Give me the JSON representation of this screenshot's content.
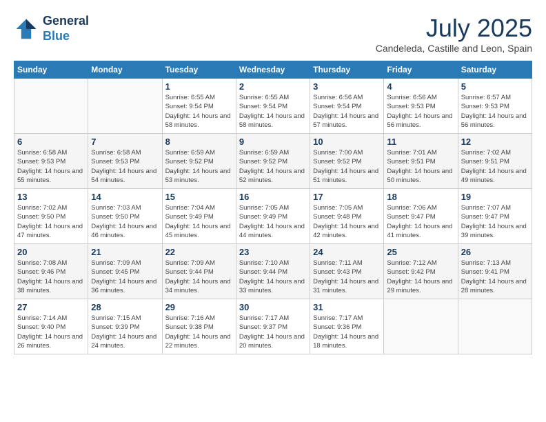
{
  "header": {
    "logo_line1": "General",
    "logo_line2": "Blue",
    "month": "July 2025",
    "location": "Candeleda, Castille and Leon, Spain"
  },
  "weekdays": [
    "Sunday",
    "Monday",
    "Tuesday",
    "Wednesday",
    "Thursday",
    "Friday",
    "Saturday"
  ],
  "weeks": [
    [
      {
        "day": "",
        "sunrise": "",
        "sunset": "",
        "daylight": ""
      },
      {
        "day": "",
        "sunrise": "",
        "sunset": "",
        "daylight": ""
      },
      {
        "day": "1",
        "sunrise": "Sunrise: 6:55 AM",
        "sunset": "Sunset: 9:54 PM",
        "daylight": "Daylight: 14 hours and 58 minutes."
      },
      {
        "day": "2",
        "sunrise": "Sunrise: 6:55 AM",
        "sunset": "Sunset: 9:54 PM",
        "daylight": "Daylight: 14 hours and 58 minutes."
      },
      {
        "day": "3",
        "sunrise": "Sunrise: 6:56 AM",
        "sunset": "Sunset: 9:54 PM",
        "daylight": "Daylight: 14 hours and 57 minutes."
      },
      {
        "day": "4",
        "sunrise": "Sunrise: 6:56 AM",
        "sunset": "Sunset: 9:53 PM",
        "daylight": "Daylight: 14 hours and 56 minutes."
      },
      {
        "day": "5",
        "sunrise": "Sunrise: 6:57 AM",
        "sunset": "Sunset: 9:53 PM",
        "daylight": "Daylight: 14 hours and 56 minutes."
      }
    ],
    [
      {
        "day": "6",
        "sunrise": "Sunrise: 6:58 AM",
        "sunset": "Sunset: 9:53 PM",
        "daylight": "Daylight: 14 hours and 55 minutes."
      },
      {
        "day": "7",
        "sunrise": "Sunrise: 6:58 AM",
        "sunset": "Sunset: 9:53 PM",
        "daylight": "Daylight: 14 hours and 54 minutes."
      },
      {
        "day": "8",
        "sunrise": "Sunrise: 6:59 AM",
        "sunset": "Sunset: 9:52 PM",
        "daylight": "Daylight: 14 hours and 53 minutes."
      },
      {
        "day": "9",
        "sunrise": "Sunrise: 6:59 AM",
        "sunset": "Sunset: 9:52 PM",
        "daylight": "Daylight: 14 hours and 52 minutes."
      },
      {
        "day": "10",
        "sunrise": "Sunrise: 7:00 AM",
        "sunset": "Sunset: 9:52 PM",
        "daylight": "Daylight: 14 hours and 51 minutes."
      },
      {
        "day": "11",
        "sunrise": "Sunrise: 7:01 AM",
        "sunset": "Sunset: 9:51 PM",
        "daylight": "Daylight: 14 hours and 50 minutes."
      },
      {
        "day": "12",
        "sunrise": "Sunrise: 7:02 AM",
        "sunset": "Sunset: 9:51 PM",
        "daylight": "Daylight: 14 hours and 49 minutes."
      }
    ],
    [
      {
        "day": "13",
        "sunrise": "Sunrise: 7:02 AM",
        "sunset": "Sunset: 9:50 PM",
        "daylight": "Daylight: 14 hours and 47 minutes."
      },
      {
        "day": "14",
        "sunrise": "Sunrise: 7:03 AM",
        "sunset": "Sunset: 9:50 PM",
        "daylight": "Daylight: 14 hours and 46 minutes."
      },
      {
        "day": "15",
        "sunrise": "Sunrise: 7:04 AM",
        "sunset": "Sunset: 9:49 PM",
        "daylight": "Daylight: 14 hours and 45 minutes."
      },
      {
        "day": "16",
        "sunrise": "Sunrise: 7:05 AM",
        "sunset": "Sunset: 9:49 PM",
        "daylight": "Daylight: 14 hours and 44 minutes."
      },
      {
        "day": "17",
        "sunrise": "Sunrise: 7:05 AM",
        "sunset": "Sunset: 9:48 PM",
        "daylight": "Daylight: 14 hours and 42 minutes."
      },
      {
        "day": "18",
        "sunrise": "Sunrise: 7:06 AM",
        "sunset": "Sunset: 9:47 PM",
        "daylight": "Daylight: 14 hours and 41 minutes."
      },
      {
        "day": "19",
        "sunrise": "Sunrise: 7:07 AM",
        "sunset": "Sunset: 9:47 PM",
        "daylight": "Daylight: 14 hours and 39 minutes."
      }
    ],
    [
      {
        "day": "20",
        "sunrise": "Sunrise: 7:08 AM",
        "sunset": "Sunset: 9:46 PM",
        "daylight": "Daylight: 14 hours and 38 minutes."
      },
      {
        "day": "21",
        "sunrise": "Sunrise: 7:09 AM",
        "sunset": "Sunset: 9:45 PM",
        "daylight": "Daylight: 14 hours and 36 minutes."
      },
      {
        "day": "22",
        "sunrise": "Sunrise: 7:09 AM",
        "sunset": "Sunset: 9:44 PM",
        "daylight": "Daylight: 14 hours and 34 minutes."
      },
      {
        "day": "23",
        "sunrise": "Sunrise: 7:10 AM",
        "sunset": "Sunset: 9:44 PM",
        "daylight": "Daylight: 14 hours and 33 minutes."
      },
      {
        "day": "24",
        "sunrise": "Sunrise: 7:11 AM",
        "sunset": "Sunset: 9:43 PM",
        "daylight": "Daylight: 14 hours and 31 minutes."
      },
      {
        "day": "25",
        "sunrise": "Sunrise: 7:12 AM",
        "sunset": "Sunset: 9:42 PM",
        "daylight": "Daylight: 14 hours and 29 minutes."
      },
      {
        "day": "26",
        "sunrise": "Sunrise: 7:13 AM",
        "sunset": "Sunset: 9:41 PM",
        "daylight": "Daylight: 14 hours and 28 minutes."
      }
    ],
    [
      {
        "day": "27",
        "sunrise": "Sunrise: 7:14 AM",
        "sunset": "Sunset: 9:40 PM",
        "daylight": "Daylight: 14 hours and 26 minutes."
      },
      {
        "day": "28",
        "sunrise": "Sunrise: 7:15 AM",
        "sunset": "Sunset: 9:39 PM",
        "daylight": "Daylight: 14 hours and 24 minutes."
      },
      {
        "day": "29",
        "sunrise": "Sunrise: 7:16 AM",
        "sunset": "Sunset: 9:38 PM",
        "daylight": "Daylight: 14 hours and 22 minutes."
      },
      {
        "day": "30",
        "sunrise": "Sunrise: 7:17 AM",
        "sunset": "Sunset: 9:37 PM",
        "daylight": "Daylight: 14 hours and 20 minutes."
      },
      {
        "day": "31",
        "sunrise": "Sunrise: 7:17 AM",
        "sunset": "Sunset: 9:36 PM",
        "daylight": "Daylight: 14 hours and 18 minutes."
      },
      {
        "day": "",
        "sunrise": "",
        "sunset": "",
        "daylight": ""
      },
      {
        "day": "",
        "sunrise": "",
        "sunset": "",
        "daylight": ""
      }
    ]
  ]
}
